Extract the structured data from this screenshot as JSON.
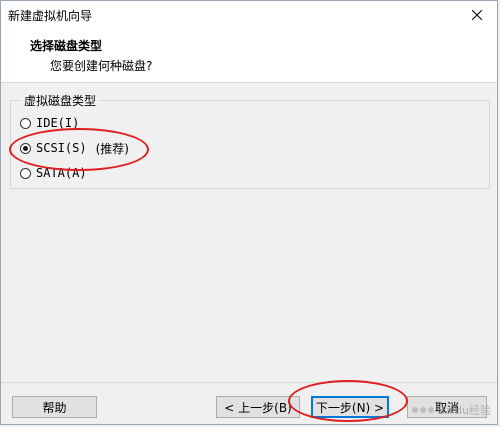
{
  "window": {
    "title": "新建虚拟机向导"
  },
  "header": {
    "title": "选择磁盘类型",
    "subtitle": "您要创建何种磁盘?"
  },
  "disk_type_group": {
    "legend": "虚拟磁盘类型",
    "options": [
      {
        "label": "IDE(I)",
        "checked": false
      },
      {
        "label": "SCSI(S)",
        "checked": true,
        "note": "(推荐)"
      },
      {
        "label": "SATA(A)",
        "checked": false
      }
    ]
  },
  "buttons": {
    "help": "帮助",
    "back": "< 上一步(B)",
    "next": "下一步(N) >",
    "cancel": "取消"
  },
  "watermark": {
    "text": "Baidu经验"
  },
  "icons": {
    "close": "close-icon",
    "radio": "radio-icon"
  },
  "colors": {
    "annotation": "#e02020",
    "focus": "#0078d7"
  }
}
